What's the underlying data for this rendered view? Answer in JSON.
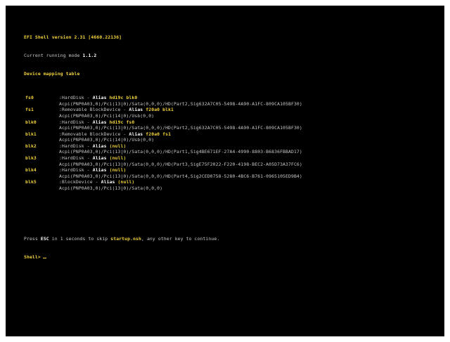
{
  "header": {
    "version_line": "EFI Shell version 2.31 [4660.22136]",
    "mode_prefix": "Current running mode ",
    "mode_value": "1.1.2",
    "mapping_title": "Device mapping table"
  },
  "mappings": [
    {
      "name": "fs0",
      "desc": ":HardDisk - ",
      "alias_label": "Alias",
      "alias_value": "hd19c blk0",
      "path": "Acpi(PNP0A03,0)/Pci(13|0)/Sata(0,0,0)/HD(Part2,Sig632A7C05-5498-4A90-A1FC-809CA105BF30)"
    },
    {
      "name": "fs1",
      "desc": ":Removable BlockDevice - ",
      "alias_label": "Alias",
      "alias_value": "f20a0 blk1",
      "path": "Acpi(PNP0A03,0)/Pci(14|0)/Usb(0,0)"
    },
    {
      "name": "blk0",
      "desc": ":HardDisk - ",
      "alias_label": "Alias",
      "alias_value": "hd19c fs0",
      "path": "Acpi(PNP0A03,0)/Pci(13|0)/Sata(0,0,0)/HD(Part2,Sig632A7C05-5498-4A90-A1FC-809CA105BF30)"
    },
    {
      "name": "blk1",
      "desc": ":Removable BlockDevice - ",
      "alias_label": "Alias",
      "alias_value": "f20a0 fs1",
      "path": "Acpi(PNP0A03,0)/Pci(14|0)/Usb(0,0)"
    },
    {
      "name": "blk2",
      "desc": ":HardDisk - ",
      "alias_label": "Alias",
      "alias_value": "(null)",
      "path": "Acpi(PNP0A03,0)/Pci(13|0)/Sata(0,0,0)/HD(Part1,Sig4BE671EF-27A4-4990-8803-B6836FBBAD17)"
    },
    {
      "name": "blk3",
      "desc": ":HardDisk - ",
      "alias_label": "Alias",
      "alias_value": "(null)",
      "path": "Acpi(PNP0A03,0)/Pci(13|0)/Sata(0,0,0)/HD(Part3,SigE75F2022-F220-4198-BEC2-A05D73A37FC6)"
    },
    {
      "name": "blk4",
      "desc": ":HardDisk - ",
      "alias_label": "Alias",
      "alias_value": "(null)",
      "path": "Acpi(PNP0A03,0)/Pci(13|0)/Sata(0,0,0)/HD(Part4,Sig2CED0758-5280-4BC6-B761-0965105ED9B4)"
    },
    {
      "name": "blk5",
      "desc": ":BlockDevice - ",
      "alias_label": "Alias",
      "alias_value": "(null)",
      "path": "Acpi(PNP0A03,0)/Pci(13|0)/Sata(0,0,0)"
    }
  ],
  "prompt": {
    "press_prefix": "Press ",
    "key": "ESC",
    "mid": " in 1 seconds to skip ",
    "script": "startup.nsh",
    "suffix": ", any other key to continue.",
    "shell_prompt": "Shell>"
  }
}
